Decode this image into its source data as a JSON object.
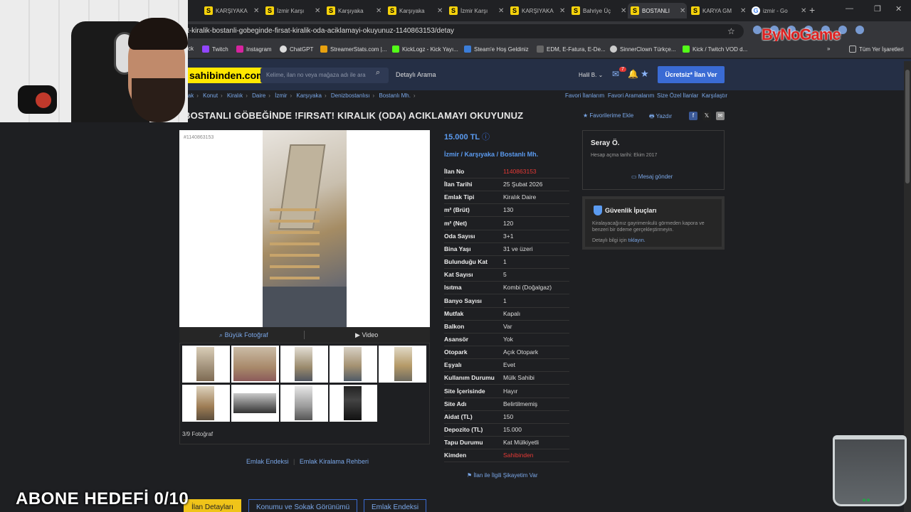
{
  "browser": {
    "tabs": [
      {
        "label": "KARŞIYAKA",
        "icon": "S"
      },
      {
        "label": "İzmir Karşı",
        "icon": "S"
      },
      {
        "label": "Karşıyaka",
        "icon": "S"
      },
      {
        "label": "Karşıyaka",
        "icon": "S"
      },
      {
        "label": "İzmir Karşı",
        "icon": "S"
      },
      {
        "label": "KARŞIYAKA",
        "icon": "S"
      },
      {
        "label": "Bahriye Üç",
        "icon": "S"
      },
      {
        "label": "BOSTANLI",
        "icon": "S"
      },
      {
        "label": "KARYA GM",
        "icon": "S"
      },
      {
        "label": "izmir - Go",
        "icon": "G"
      }
    ],
    "url": "t-kiralik-bostanli-gobeginde-firsat-kiralik-oda-aciklamayi-okuyunuz-1140863153/detay",
    "bookmarks": [
      "ck",
      "Twitch",
      "Instagram",
      "ChatGPT",
      "StreamerStats.com |...",
      "KickLogz - Kick Yayı...",
      "Steam'e Hoş Geldiniz",
      "EDM, E-Fatura, E-De...",
      "SinnerClown Türkçe...",
      "Kick / Twitch VOD d..."
    ],
    "all_bookmarks": "Tüm Yer İşaretleri",
    "overlay_logo": "ByNoGame"
  },
  "site": {
    "brand": "sahibinden.com",
    "search_placeholder": "Kelime, ilan no veya mağaza adı ile ara",
    "detailed_search": "Detaylı Arama",
    "user": "Halil B.",
    "message_count": "7",
    "post_ad": "Ücretsiz* İlan Ver"
  },
  "breadcrumb": [
    "lak",
    "Konut",
    "Kiralık",
    "Daire",
    "İzmir",
    "Karşıyaka",
    "Denizbostanlısı",
    "Bostanlı Mh."
  ],
  "right_links": [
    "Favori İlanlarım",
    "Favori Aramalarım",
    "Size Özel İlanlar",
    "Karşılaştır"
  ],
  "listing": {
    "title": "BOSTANLI GÖBEĞİNDE !FIRSAT! KIRALIK (ODA) ACIKLAMAYI OKUYUNUZ",
    "add_favorite": "Favorilerime Ekle",
    "print": "Yazdır",
    "photo_id": "#1140863153",
    "big_photo": "Büyük Fotoğraf",
    "video": "Video",
    "photo_count": "3/9 Fotoğraf",
    "price": "15.000 TL",
    "location": [
      "İzmir",
      "Karşıyaka",
      "Bostanlı Mh."
    ],
    "complaint": "İlan ile İlgili Şikayetim Var"
  },
  "details": [
    {
      "k": "İlan No",
      "v": "1140863153",
      "red": true
    },
    {
      "k": "İlan Tarihi",
      "v": "25 Şubat 2026"
    },
    {
      "k": "Emlak Tipi",
      "v": "Kiralık Daire"
    },
    {
      "k": "m² (Brüt)",
      "v": "130"
    },
    {
      "k": "m² (Net)",
      "v": "120"
    },
    {
      "k": "Oda Sayısı",
      "v": "3+1"
    },
    {
      "k": "Bina Yaşı",
      "v": "31 ve üzeri"
    },
    {
      "k": "Bulunduğu Kat",
      "v": "1"
    },
    {
      "k": "Kat Sayısı",
      "v": "5"
    },
    {
      "k": "Isıtma",
      "v": "Kombi (Doğalgaz)"
    },
    {
      "k": "Banyo Sayısı",
      "v": "1"
    },
    {
      "k": "Mutfak",
      "v": "Kapalı"
    },
    {
      "k": "Balkon",
      "v": "Var"
    },
    {
      "k": "Asansör",
      "v": "Yok"
    },
    {
      "k": "Otopark",
      "v": "Açık Otopark"
    },
    {
      "k": "Eşyalı",
      "v": "Evet"
    },
    {
      "k": "Kullanım Durumu",
      "v": "Mülk Sahibi"
    },
    {
      "k": "Site İçerisinde",
      "v": "Hayır"
    },
    {
      "k": "Site Adı",
      "v": "Belirtilmemiş"
    },
    {
      "k": "Aidat (TL)",
      "v": "150"
    },
    {
      "k": "Depozito (TL)",
      "v": "15.000"
    },
    {
      "k": "Tapu Durumu",
      "v": "Kat Mülkiyetli"
    },
    {
      "k": "Kimden",
      "v": "Sahibinden",
      "red": true
    }
  ],
  "seller": {
    "name": "Seray Ö.",
    "since": "Hesap açma tarihi: Ekim 2017",
    "message": "Mesaj gönder"
  },
  "tips": {
    "title": "Güvenlik İpuçları",
    "text": "Kiralayacağınız gayrimenkulü görmeden kapora ve benzeri bir ödeme gerçekleştirmeyin.",
    "more": "Detaylı bilgi için",
    "link": "tıklayın."
  },
  "bottom": {
    "links": [
      "Emlak Endeksi",
      "Emlak Kiralama Rehberi"
    ],
    "tabs": [
      "İlan Detayları",
      "Konumu ve Sokak Görünümü",
      "Emlak Endeksi"
    ]
  },
  "overlay": {
    "goal": "ABONE HEDEFİ 0/10"
  }
}
